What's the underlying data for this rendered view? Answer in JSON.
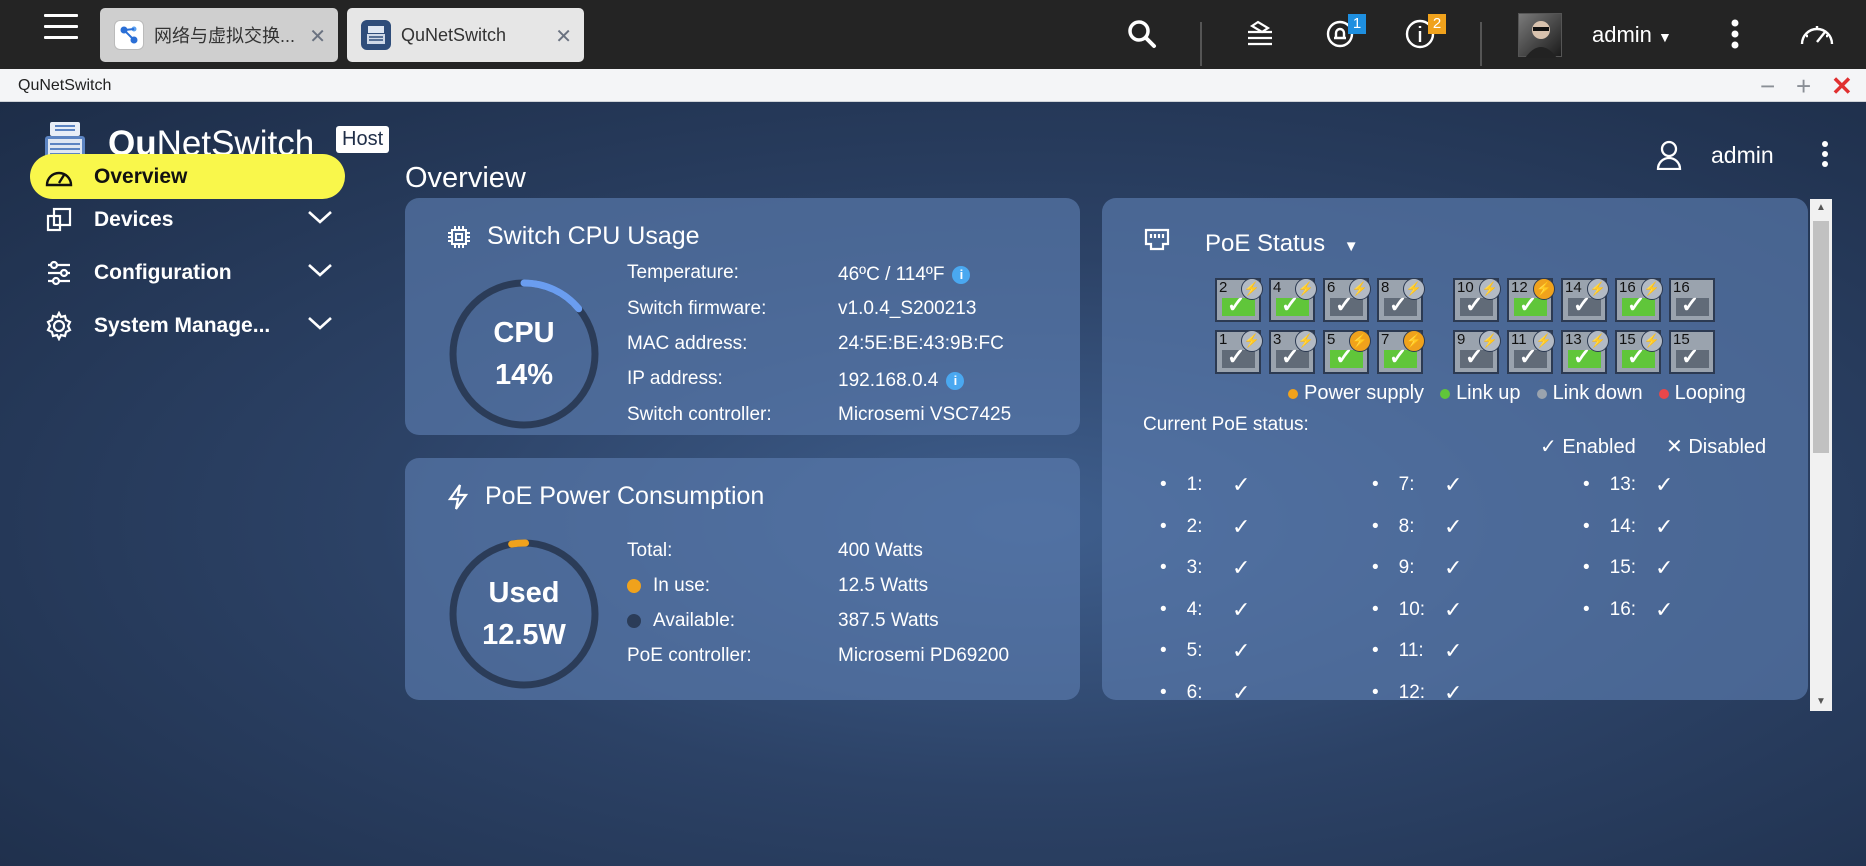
{
  "topbar": {
    "tabs": [
      {
        "label": "网络与虚拟交换..."
      },
      {
        "label": "QuNetSwitch"
      }
    ],
    "notifications_count": "1",
    "info_count": "2",
    "user": "admin"
  },
  "window": {
    "title": "QuNetSwitch"
  },
  "app": {
    "title_bold": "Qu",
    "title_rest": "NetSwitch",
    "host_badge": "Host",
    "user": "admin"
  },
  "nav": {
    "items": [
      {
        "label": "Overview"
      },
      {
        "label": "Devices"
      },
      {
        "label": "Configuration"
      },
      {
        "label": "System Manage..."
      }
    ]
  },
  "page": {
    "title": "Overview"
  },
  "cpu_card": {
    "title": "Switch CPU Usage",
    "ring_top": "CPU",
    "ring_bottom": "14%",
    "usage_fraction": 0.14,
    "rows": [
      {
        "label": "Temperature:",
        "value": "46ºC / 114ºF"
      },
      {
        "label": "Switch firmware:",
        "value": "v1.0.4_S200213"
      },
      {
        "label": "MAC address:",
        "value": "24:5E:BE:43:9B:FC"
      },
      {
        "label": "IP address:",
        "value": "192.168.0.4"
      },
      {
        "label": "Switch controller:",
        "value": "Microsemi VSC7425"
      }
    ]
  },
  "poe_power": {
    "title": "PoE Power Consumption",
    "ring_top": "Used",
    "ring_bottom": "12.5W",
    "usage_fraction": 0.03125,
    "rows": [
      {
        "label": "Total:",
        "value": "400 Watts"
      },
      {
        "label": "In use:",
        "value": "12.5 Watts"
      },
      {
        "label": "Available:",
        "value": "387.5 Watts"
      },
      {
        "label": "PoE controller:",
        "value": "Microsemi PD69200"
      }
    ],
    "colors": {
      "in_use": "#f0a21c",
      "available": "#2b3c58"
    }
  },
  "poe_status": {
    "title": "PoE Status",
    "ports_top": [
      {
        "num": "2",
        "link": "up",
        "power": false
      },
      {
        "num": "4",
        "link": "up",
        "power": false
      },
      {
        "num": "6",
        "link": "down",
        "power": false
      },
      {
        "num": "8",
        "link": "down",
        "power": false
      },
      {
        "num": "10",
        "link": "down",
        "power": false
      },
      {
        "num": "12",
        "link": "up",
        "power": true
      },
      {
        "num": "14",
        "link": "down",
        "power": false
      },
      {
        "num": "16",
        "link": "up",
        "power": false
      },
      {
        "num": "16",
        "link": "down",
        "power": null
      }
    ],
    "ports_bottom": [
      {
        "num": "1",
        "link": "down",
        "power": false
      },
      {
        "num": "3",
        "link": "down",
        "power": false
      },
      {
        "num": "5",
        "link": "up",
        "power": true
      },
      {
        "num": "7",
        "link": "up",
        "power": true
      },
      {
        "num": "9",
        "link": "down",
        "power": false
      },
      {
        "num": "11",
        "link": "down",
        "power": false
      },
      {
        "num": "13",
        "link": "up",
        "power": false
      },
      {
        "num": "15",
        "link": "up",
        "power": false
      },
      {
        "num": "15",
        "link": "down",
        "power": null
      }
    ],
    "legend": [
      {
        "label": "Power supply",
        "color": "#f0a21c"
      },
      {
        "label": "Link up",
        "color": "#60c63a"
      },
      {
        "label": "Link down",
        "color": "#9aa3ae"
      },
      {
        "label": "Looping",
        "color": "#e8474a"
      }
    ],
    "current_label": "Current PoE status:",
    "enabled_label": "Enabled",
    "disabled_label": "Disabled",
    "columns": [
      [
        "1:",
        "2:",
        "3:",
        "4:",
        "5:",
        "6:"
      ],
      [
        "7:",
        "8:",
        "9:",
        "10:",
        "11:",
        "12:"
      ],
      [
        "13:",
        "14:",
        "15:",
        "16:"
      ]
    ]
  }
}
